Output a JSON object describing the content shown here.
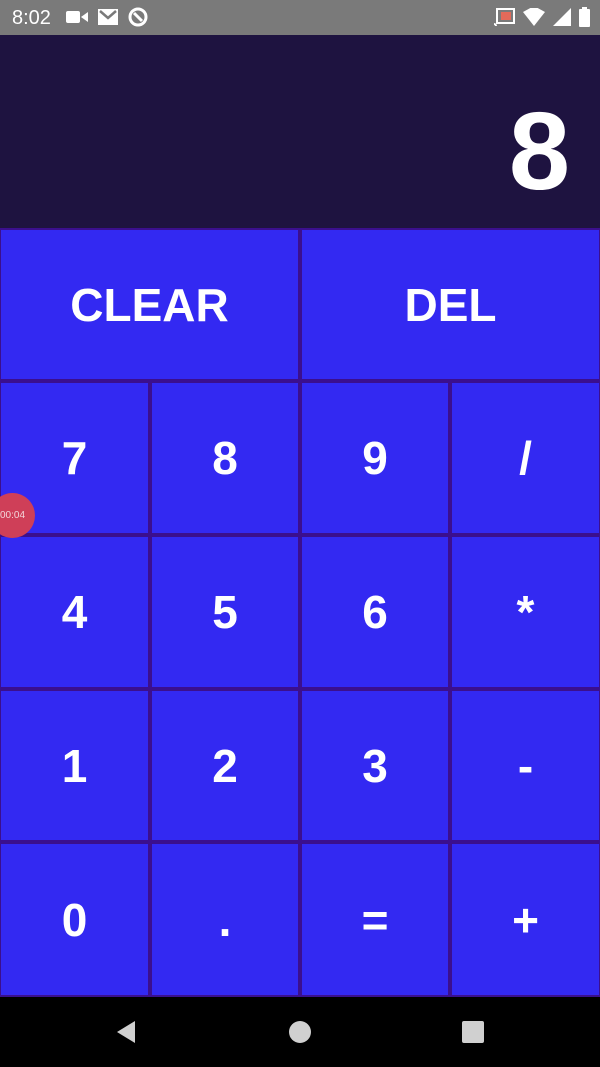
{
  "status_bar": {
    "time": "8:02",
    "left_icons": [
      "video-camera-icon",
      "gmail-icon",
      "sync-icon"
    ],
    "right_icons": [
      "cast-icon",
      "wifi-icon",
      "signal-icon",
      "battery-icon"
    ]
  },
  "display": {
    "value": "8"
  },
  "keys": {
    "clear": "CLEAR",
    "del": "DEL",
    "seven": "7",
    "eight": "8",
    "nine": "9",
    "divide": "/",
    "four": "4",
    "five": "5",
    "six": "6",
    "multiply": "*",
    "one": "1",
    "two": "2",
    "three": "3",
    "minus": "-",
    "zero": "0",
    "dot": ".",
    "equals": "=",
    "plus": "+"
  },
  "overlay": {
    "timer": "00:04"
  },
  "nav": {
    "buttons": [
      "back-icon",
      "home-icon",
      "recents-icon"
    ]
  },
  "colors": {
    "status_bar": "#7a7a7a",
    "display_bg": "#1e1340",
    "key_bg": "#3329f2",
    "key_border": "#3b0f8e",
    "timer_bubble": "#cf3f58"
  }
}
